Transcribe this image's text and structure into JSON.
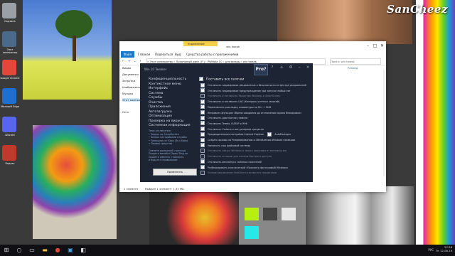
{
  "watermark": "SanCheez",
  "desktop_icons": [
    {
      "label": "Корзина",
      "color": "#9aa0a6"
    },
    {
      "label": "Этот компьютер",
      "color": "#4a6a8a"
    },
    {
      "label": "Google Chrome",
      "color": "#e4463a"
    },
    {
      "label": "Microsoft Edge",
      "color": "#1e6fd0"
    },
    {
      "label": "Discord",
      "color": "#5865f2"
    },
    {
      "label": "Яндекс",
      "color": "#c0392b"
    }
  ],
  "explorer": {
    "ribbon_tab_highlight": "Управление",
    "window_title": "win tweak",
    "menu": {
      "file": "Файл",
      "home": "Главная",
      "share": "Поделиться",
      "view": "Вид",
      "manage": "Средства работы с приложениями"
    },
    "address": "« Этот компьютер › Локальный диск (F:) › РWНdia 10 › для винды › win tweak",
    "search_placeholder": "Поиск: win tweak",
    "columns": {
      "name": "Имя",
      "date": "Дата изменения",
      "type": "Тип",
      "size": "Размер"
    },
    "sidebar": [
      {
        "label": "Видео"
      },
      {
        "label": "Документы"
      },
      {
        "label": "Загрузки"
      },
      {
        "label": "Изображения"
      },
      {
        "label": "Музыка"
      },
      {
        "label": "Этот компьютер"
      },
      {
        "label": "Сеть"
      }
    ],
    "status": {
      "count": "1 элемент",
      "selected": "Выбран 1 элемент: 1,32 МБ"
    }
  },
  "tweaker": {
    "title": "Win 10 Tweaker",
    "pro_badge": "Pro?",
    "section_title": "Поставить все галочки",
    "categories": [
      "Конфиденциальность",
      "Контекстное меню",
      "Интерфейс",
      "Система",
      "Службы",
      "Очистка",
      "Приложения",
      "Автозагрузка",
      "Оптимизация",
      "Проверка на вирусы",
      "Системная информация"
    ],
    "links": [
      "Тема отключения:",
      "• Запрос на SmartScreen",
      "• Запрос настройками службы",
      "• Помощник от Xbox (To и Xbox)",
      "• Первые средства",
      "",
      "Смените домашний страницы",
      "Google и меняйте Эдиш Bing на",
      "Google и сменить стоимость",
      "и будьте в правильном"
    ],
    "apply_button": "Применить",
    "options": [
      {
        "label": "Отключить надоедливое уведомление о безопасности из Центра уведомлений",
        "checked": true
      },
      {
        "label": "Отключить надоедливое предупреждение при запуске любых exe",
        "checked": true
      },
      {
        "label": "Отключить и отключить Защитник Windows и SmartScreen",
        "checked": false
      },
      {
        "label": "Отключить и отключить UAC (Контроль учетных записей)",
        "checked": true
      },
      {
        "label": "Переключить раскладку клавиатуры по Ctrl + Shift",
        "checked": true
      },
      {
        "label": "Исправить функцию «Время ожидания до отключения экрана блокировки»",
        "checked": true
      },
      {
        "label": "Отключить диагностику памяти",
        "checked": true
      },
      {
        "label": "Отключить Teredo, ISATAP и IPv6",
        "checked": true
      },
      {
        "label": "Отключить Cortana и все дочерние процессы",
        "checked": true
      },
      {
        "label": "Предварительная настройка Internet Explorer",
        "checked": true,
        "extra": "AutoDarkaper"
      },
      {
        "label": "Создать архивы по Резервированию и Обновлению Windows правками",
        "checked": true
      },
      {
        "label": "Увеличить кэш файловой системы",
        "checked": true
      },
      {
        "label": "Отключить запуск Windows и запуск программ из автозагрузки",
        "checked": false
      },
      {
        "label": "Отключить историю для значков быстрого доступа",
        "checked": false
      },
      {
        "label": "Отключить автозапуск съёмных носителей",
        "checked": true
      },
      {
        "label": "Разблокировать классический «Просмотр фотографий Windows»",
        "checked": true
      },
      {
        "label": "Полное выключение OneDrive со всеми его процессами",
        "checked": false
      }
    ]
  },
  "taskbar": {
    "lang": "РУС",
    "time": "22:38",
    "date": "Пт 12.08.19"
  }
}
